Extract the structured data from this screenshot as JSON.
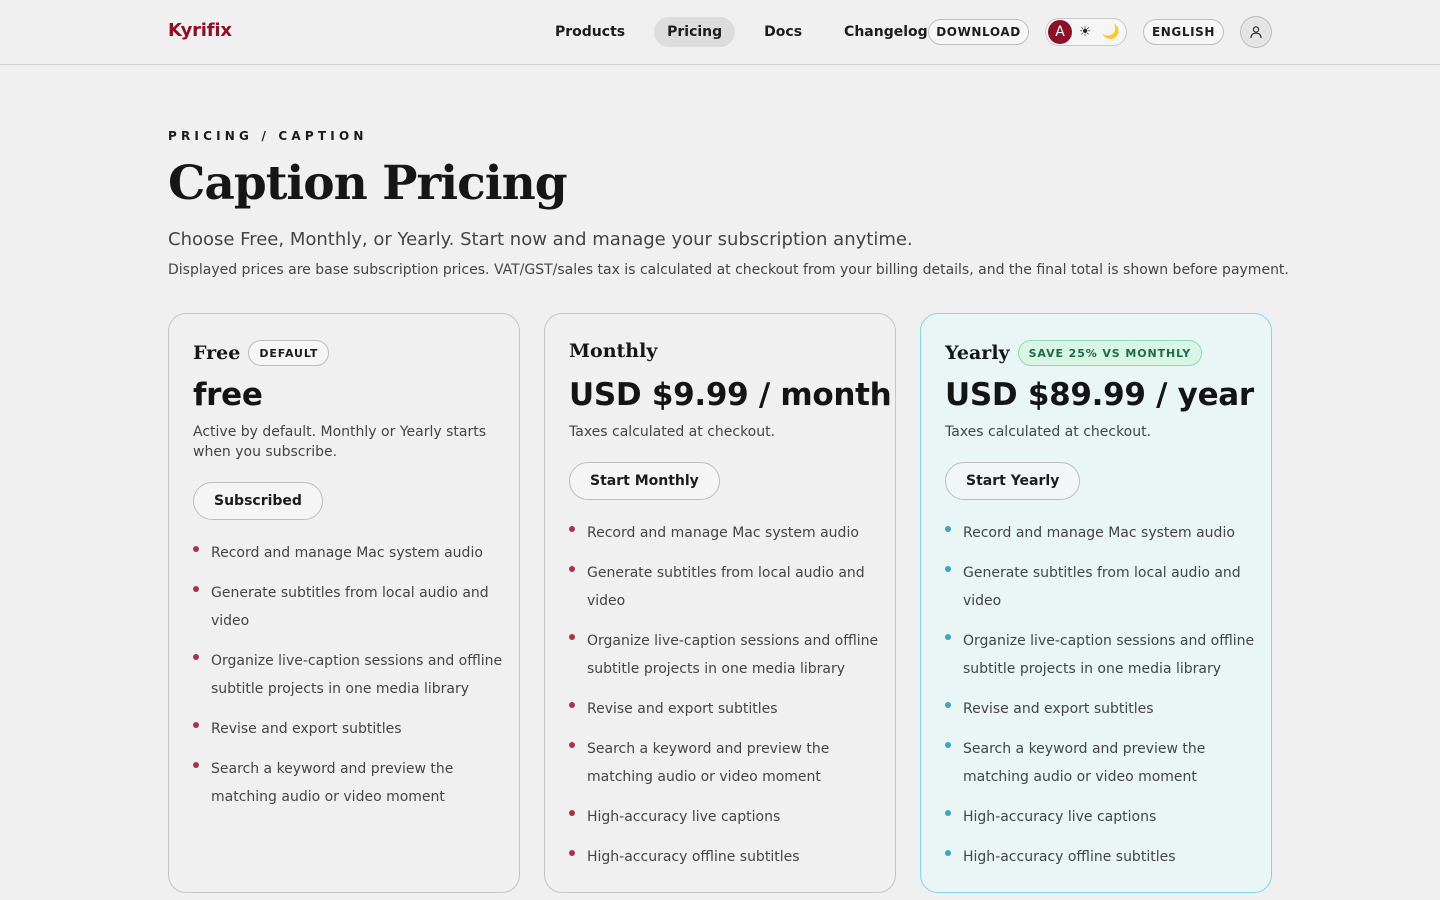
{
  "brand": "Kyrifix",
  "nav": {
    "links": [
      "Products",
      "Pricing",
      "Docs",
      "Changelog"
    ],
    "active_index": 1,
    "download_label": "DOWNLOAD",
    "language_label": "ENGLISH",
    "theme_options": {
      "auto": "A",
      "light": "☀",
      "dark": "🌙"
    },
    "selected_theme": "auto"
  },
  "hero": {
    "eyebrow": "PRICING / CAPTION",
    "title": "Caption Pricing",
    "subtitle": "Choose Free, Monthly, or Yearly. Start now and manage your subscription anytime.",
    "note": "Displayed prices are base subscription prices. VAT/GST/sales tax is calculated at checkout from your billing details, and the final total is shown before payment."
  },
  "colors": {
    "brand": "#8c1028",
    "bullet_default": "#a8324a",
    "bullet_yearly": "#3aa6bf",
    "yearly_border": "#7fd6e8",
    "save_badge_bg": "#d8f5e6",
    "save_badge_text": "#1f6b45"
  },
  "plans": [
    {
      "name": "Free",
      "badge": "DEFAULT",
      "price": "free",
      "description": "Active by default. Monthly or Yearly starts when you subscribe.",
      "cta": "Subscribed",
      "features": [
        "Record and manage Mac system audio",
        "Generate subtitles from local audio and video",
        "Organize live-caption sessions and offline subtitle projects in one media library",
        "Revise and export subtitles",
        "Search a keyword and preview the matching audio or video moment"
      ]
    },
    {
      "name": "Monthly",
      "badge": "",
      "price": "USD $9.99 / month",
      "description": "Taxes calculated at checkout.",
      "cta": "Start Monthly",
      "features": [
        "Record and manage Mac system audio",
        "Generate subtitles from local audio and video",
        "Organize live-caption sessions and offline subtitle projects in one media library",
        "Revise and export subtitles",
        "Search a keyword and preview the matching audio or video moment",
        "High-accuracy live captions",
        "High-accuracy offline subtitles"
      ]
    },
    {
      "name": "Yearly",
      "badge": "SAVE 25% VS MONTHLY",
      "price": "USD $89.99 / year",
      "description": "Taxes calculated at checkout.",
      "cta": "Start Yearly",
      "features": [
        "Record and manage Mac system audio",
        "Generate subtitles from local audio and video",
        "Organize live-caption sessions and offline subtitle projects in one media library",
        "Revise and export subtitles",
        "Search a keyword and preview the matching audio or video moment",
        "High-accuracy live captions",
        "High-accuracy offline subtitles"
      ]
    }
  ]
}
